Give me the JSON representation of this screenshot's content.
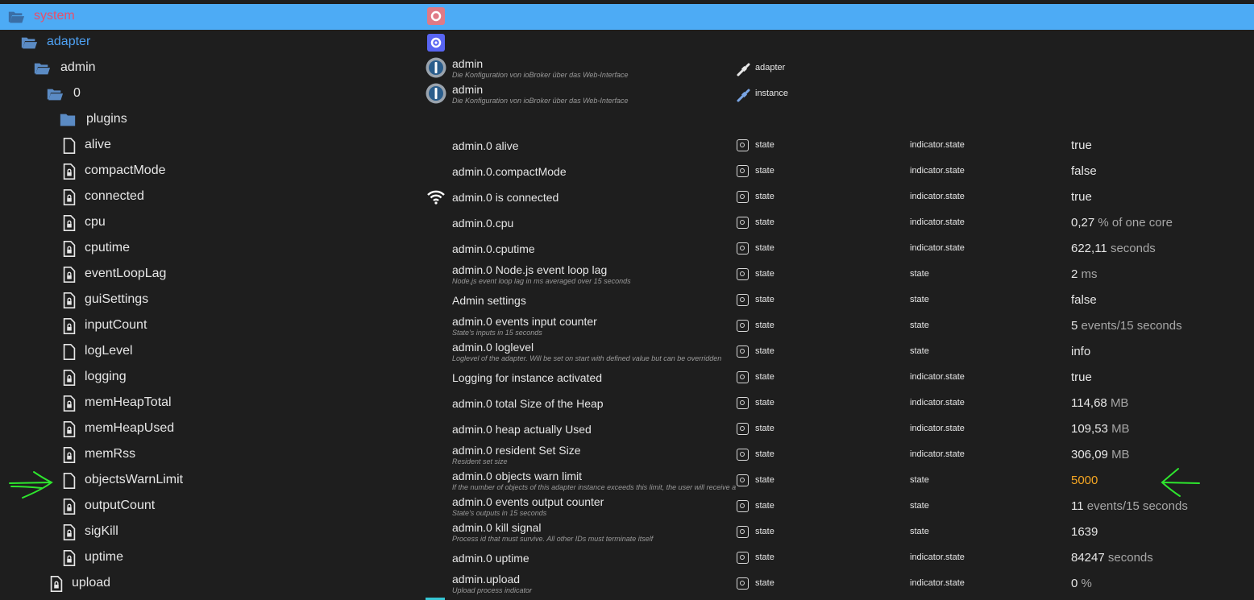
{
  "tree": {
    "system": {
      "label": "system"
    },
    "adapter": {
      "label": "adapter"
    },
    "admin": {
      "label": "admin",
      "name": "admin",
      "desc": "Die Konfiguration von ioBroker über das Web-Interface",
      "type": "adapter"
    },
    "instance0": {
      "label": "0",
      "name": "admin",
      "desc": "Die Konfiguration von ioBroker über das Web-Interface",
      "type": "instance"
    },
    "plugins": {
      "label": "plugins"
    },
    "upload": {
      "label": "upload",
      "name": "admin.upload",
      "desc": "Upload process indicator",
      "type": "state",
      "role": "indicator.state",
      "value": "0",
      "unit": "%"
    }
  },
  "states": [
    {
      "label": "alive",
      "name": "admin.0 alive",
      "desc": "",
      "type": "state",
      "role": "indicator.state",
      "value": "true",
      "unit": ""
    },
    {
      "label": "compactMode",
      "name": "admin.0.compactMode",
      "desc": "",
      "type": "state",
      "role": "indicator.state",
      "value": "false",
      "unit": ""
    },
    {
      "label": "connected",
      "name": "admin.0 is connected",
      "desc": "",
      "type": "state",
      "role": "indicator.state",
      "value": "true",
      "unit": ""
    },
    {
      "label": "cpu",
      "name": "admin.0.cpu",
      "desc": "",
      "type": "state",
      "role": "indicator.state",
      "value": "0,27",
      "unit": "% of one core"
    },
    {
      "label": "cputime",
      "name": "admin.0.cputime",
      "desc": "",
      "type": "state",
      "role": "indicator.state",
      "value": "622,11",
      "unit": "seconds"
    },
    {
      "label": "eventLoopLag",
      "name": "admin.0 Node.js event loop lag",
      "desc": "Node.js event loop lag in ms averaged over 15 seconds",
      "type": "state",
      "role": "state",
      "value": "2",
      "unit": "ms"
    },
    {
      "label": "guiSettings",
      "name": "Admin settings",
      "desc": "",
      "type": "state",
      "role": "state",
      "value": "false",
      "unit": ""
    },
    {
      "label": "inputCount",
      "name": "admin.0 events input counter",
      "desc": "State's inputs in 15 seconds",
      "type": "state",
      "role": "state",
      "value": "5",
      "unit": "events/15 seconds"
    },
    {
      "label": "logLevel",
      "name": "admin.0 loglevel",
      "desc": "Loglevel of the adapter. Will be set on start with defined value but can be overridden",
      "type": "state",
      "role": "state",
      "value": "info",
      "unit": ""
    },
    {
      "label": "logging",
      "name": "Logging for instance activated",
      "desc": "",
      "type": "state",
      "role": "indicator.state",
      "value": "true",
      "unit": ""
    },
    {
      "label": "memHeapTotal",
      "name": "admin.0 total Size of the Heap",
      "desc": "",
      "type": "state",
      "role": "indicator.state",
      "value": "114,68",
      "unit": "MB"
    },
    {
      "label": "memHeapUsed",
      "name": "admin.0 heap actually Used",
      "desc": "",
      "type": "state",
      "role": "indicator.state",
      "value": "109,53",
      "unit": "MB"
    },
    {
      "label": "memRss",
      "name": "admin.0 resident Set Size",
      "desc": "Resident set size",
      "type": "state",
      "role": "indicator.state",
      "value": "306,09",
      "unit": "MB"
    },
    {
      "label": "objectsWarnLimit",
      "name": "admin.0 objects warn limit",
      "desc": "If the number of objects of this adapter instance exceeds this limit, the user will receive a warning",
      "type": "state",
      "role": "state",
      "value": "5000",
      "unit": ""
    },
    {
      "label": "outputCount",
      "name": "admin.0 events output counter",
      "desc": "State's outputs in 15 seconds",
      "type": "state",
      "role": "state",
      "value": "11",
      "unit": "events/15 seconds"
    },
    {
      "label": "sigKill",
      "name": "admin.0 kill signal",
      "desc": "Process id that must survive. All other IDs must terminate itself",
      "type": "state",
      "role": "state",
      "value": "1639",
      "unit": ""
    },
    {
      "label": "uptime",
      "name": "admin.0 uptime",
      "desc": "",
      "type": "state",
      "role": "indicator.state",
      "value": "84247",
      "unit": "seconds"
    }
  ],
  "colors": {
    "background": "#1e1e1e",
    "selected_row": "#4dabf5",
    "system_text": "#e94f6b",
    "adapter_text": "#4ea1f3",
    "folder_icon": "#5b8bc4",
    "warn_value": "#f5a623",
    "annotation_arrow": "#2ee62e"
  },
  "icons": {
    "folder_open": "folder-open-icon",
    "folder_closed": "folder-icon",
    "file": "file-icon",
    "file_locked": "file-lock-icon",
    "admin_logo": "iobroker-admin-icon",
    "gear": "gear-icon",
    "wifi": "wifi-icon"
  }
}
